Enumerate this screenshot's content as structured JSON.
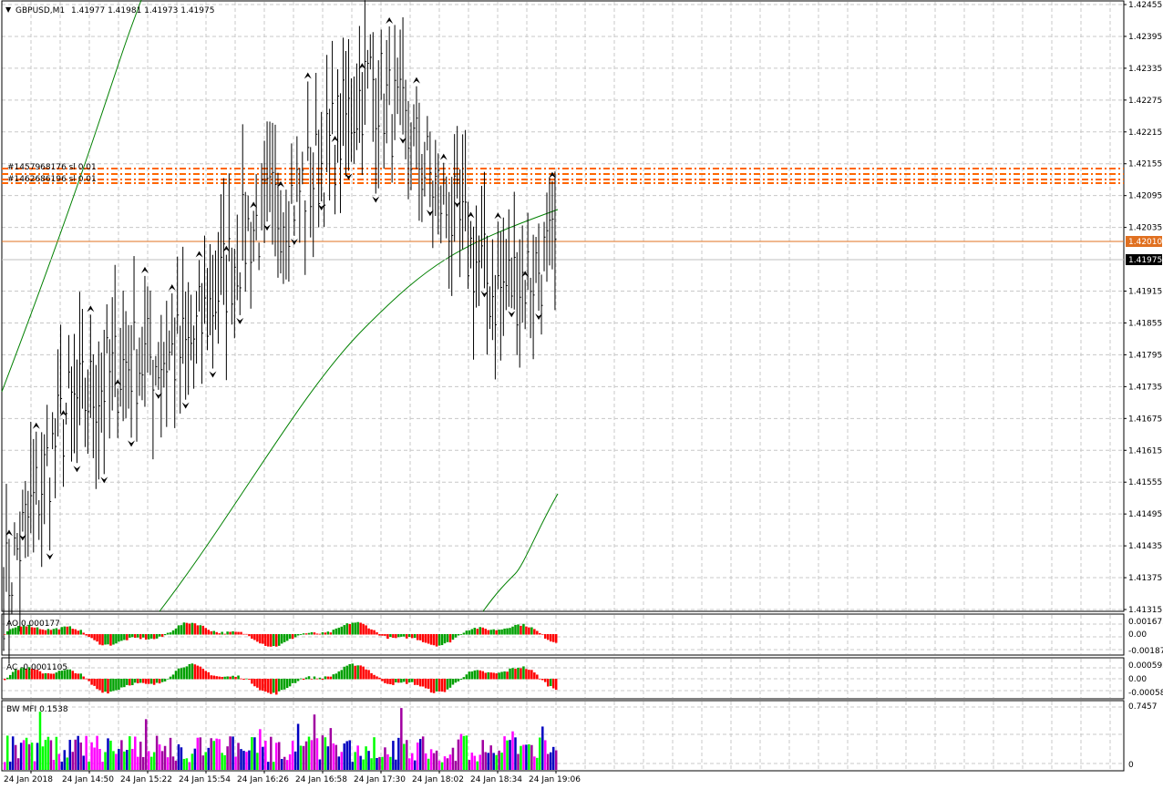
{
  "header": {
    "triangle_icon": "▼",
    "symbol": "GBPUSD,M1",
    "ohlc": "1.41977 1.41981 1.41973 1.41975"
  },
  "main_axis": {
    "labels": [
      "1.42455",
      "1.42395",
      "1.42335",
      "1.42275",
      "1.42215",
      "1.42155",
      "1.42095",
      "1.42035",
      "1.41915",
      "1.41855",
      "1.41795",
      "1.41735",
      "1.41675",
      "1.41615",
      "1.41555",
      "1.41495",
      "1.41435",
      "1.41375",
      "1.41315"
    ],
    "ymax": 1.42455,
    "ymin": 1.41315,
    "line_price_label": "1.42010",
    "bid_price_label": "1.41975"
  },
  "level_labels": [
    "#1457968176 sl 0.01",
    "#1462686196 sl 0.01"
  ],
  "time_axis": [
    "24 Jan 2018",
    "24 Jan 14:50",
    "24 Jan 15:22",
    "24 Jan 15:54",
    "24 Jan 16:26",
    "24 Jan 16:58",
    "24 Jan 17:30",
    "24 Jan 18:02",
    "24 Jan 18:34",
    "24 Jan 19:06"
  ],
  "ao_panel": {
    "label": "AO 0.000177",
    "axis": [
      "0.001675",
      "0.00",
      "-0.001875"
    ]
  },
  "ac_panel": {
    "label": "AC -0.0001105",
    "axis": [
      "0.000592",
      "0.00",
      "-0.000582"
    ]
  },
  "mfi_panel": {
    "label": "BW MFI 0.1538",
    "axis": [
      "0.7457",
      "0"
    ]
  },
  "colors": {
    "up": "#00a000",
    "down": "#ff0000",
    "ma": "#008000",
    "level": "#ff6600",
    "price_line": "#e07020",
    "bid_box": "#000000",
    "mfi": [
      "#0000c0",
      "#ff00ff",
      "#00ff00",
      "#a000a0"
    ]
  },
  "chart_data": [
    {
      "type": "line",
      "title": "GBPUSD,M1",
      "x": [
        "24 Jan 2018",
        "24 Jan 14:50",
        "24 Jan 15:22",
        "24 Jan 15:54",
        "24 Jan 16:26",
        "24 Jan 16:58",
        "24 Jan 17:30",
        "24 Jan 18:02",
        "24 Jan 18:34",
        "24 Jan 19:06"
      ],
      "series": [
        {
          "values": [
            1.4135,
            1.4168,
            1.4178,
            1.418,
            1.4203,
            1.4212,
            1.4232,
            1.4212,
            1.4191,
            1.4198
          ]
        }
      ],
      "ylim": [
        1.41315,
        1.42455
      ],
      "grid": true
    }
  ]
}
